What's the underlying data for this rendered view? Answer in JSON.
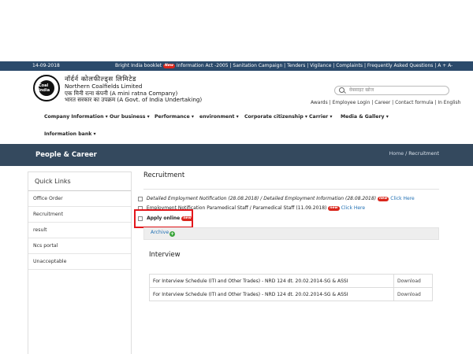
{
  "topbar": {
    "date": "14-09-2018",
    "links_before_badge": "Bright India booklet",
    "new_badge": "New",
    "links_after_badge": "Information Act -2005 | Sanitation Campaign | Tenders | Vigilance | Complaints | Frequently Asked Questions | A + A-"
  },
  "header": {
    "logo_text": "Coal India",
    "hindi_name": "नॉर्दर्न कोलफील्ड्स लिमिटेड",
    "english_name": "Northern Coalfields Limited",
    "hindi_line2": "एक मिनी रत्ना कंपनी (A mini ratna Company)",
    "hindi_line3": "भारत सरकार का उपक्रम (A Govt. of India Undertaking)",
    "search_placeholder": "वेबसाइट खोज",
    "quick_links": "Awards | Employee Login | Career | Contact formula | In English"
  },
  "nav": {
    "items": [
      "Company Information ▾",
      "Our business ▾",
      "Performance ▾",
      "environment ▾",
      "Corporate citizenship ▾",
      "Carrier ▾",
      "Media & Gallery ▾",
      "Information bank ▾"
    ]
  },
  "banner": {
    "title": "People & Career",
    "home": "Home",
    "separator": "/",
    "current": "Recruitment"
  },
  "sidebar": {
    "heading": "Quick Links",
    "items": [
      "Office Order",
      "Recruitment",
      "result",
      "Ncs portal",
      "Unacceptable"
    ]
  },
  "main": {
    "title": "Recruitment",
    "items": [
      {
        "text": "Detailed Employment Notification (28.08.2018) / Detailed Employment Information (28.08.2018)",
        "badge": "new",
        "link": "Click Here"
      },
      {
        "text": "Employment Notification Paramedical Staff / Paramedical Staff (11.09.2018)",
        "badge": "new",
        "link": "Click Here"
      },
      {
        "text": "Apply online",
        "badge": "new",
        "link": ""
      }
    ],
    "archive": "Archive",
    "interview_title": "Interview",
    "interview_rows": [
      {
        "text": "For Interview Schedule (ITI and Other Trades) - NRD 124 dt. 20.02.2014-SG & ASSI",
        "action": "Download"
      },
      {
        "text": "For Interview Schedule (ITI and Other Trades) - NRD 124 dt. 20.02.2014-SG & ASSI",
        "action": "Download"
      }
    ]
  },
  "colors": {
    "topbar_bg": "#2b4a6b",
    "banner_bg": "#34495e",
    "link": "#1f6fb3",
    "badge": "#d9261c",
    "highlight": "#e3161b"
  }
}
